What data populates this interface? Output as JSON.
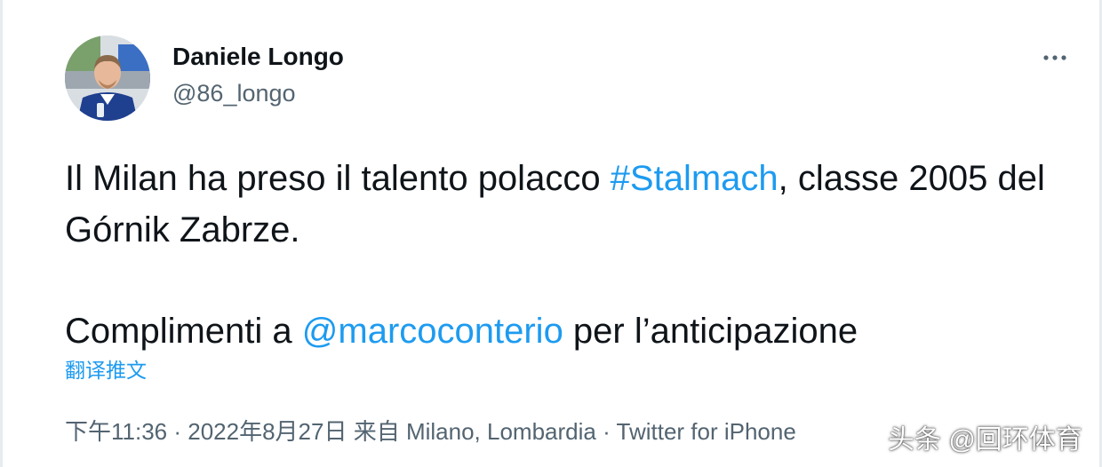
{
  "author": {
    "name": "Daniele Longo",
    "handle": "@86_longo"
  },
  "menu": {
    "icon": "more-horizontal-icon"
  },
  "tweet": {
    "line1_before": "Il Milan ha preso il talento polacco ",
    "hashtag": "#Stalmach",
    "line1_after": ", classe 2005 del Górnik Zabrze.",
    "line2_before": "Complimenti a ",
    "mention": "@marcoconterio",
    "line2_after": " per l’anticipazione"
  },
  "translate_label": "翻译推文",
  "meta": {
    "time": "下午11:36",
    "separator": " · ",
    "date": "2022年8月27日",
    "from_label": "来自",
    "location": "Milano, Lombardia",
    "source": "Twitter for iPhone"
  },
  "watermark": "头条 @回环体育",
  "colors": {
    "link": "#1d9bf0",
    "secondary_text": "#536471",
    "primary_text": "#0f1419"
  }
}
